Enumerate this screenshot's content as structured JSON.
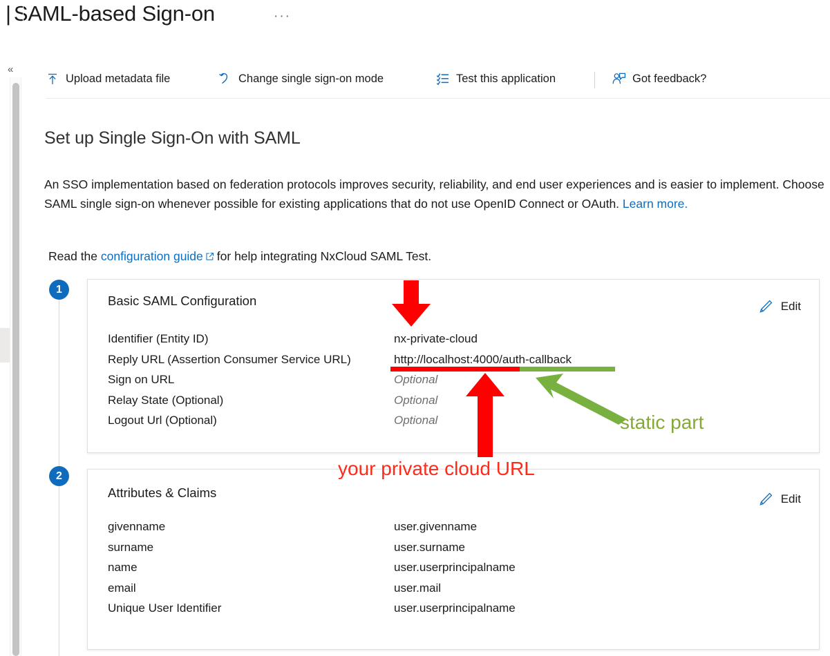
{
  "header": {
    "title_prefix": "|",
    "title": "SAML-based Sign-on",
    "ellipsis": "···",
    "collapse_icon": "«"
  },
  "command_bar": {
    "items": [
      {
        "label": "Upload metadata file",
        "icon": "upload-icon"
      },
      {
        "label": "Change single sign-on mode",
        "icon": "undo-arrow-icon"
      },
      {
        "label": "Test this application",
        "icon": "checklist-icon"
      },
      {
        "label": "Got feedback?",
        "icon": "feedback-person-icon"
      }
    ]
  },
  "main": {
    "heading": "Set up Single Sign-On with SAML",
    "intro_part1": "An SSO implementation based on federation protocols improves security, reliability, and end user experiences and is easier to implement. Choose SAML single sign-on whenever possible for existing applications that do not use OpenID Connect or OAuth. ",
    "intro_link": "Learn more.",
    "read_prefix": "Read the ",
    "read_link": "configuration guide",
    "read_suffix": "for help integrating NxCloud SAML Test."
  },
  "steps": [
    {
      "number": "1"
    },
    {
      "number": "2"
    }
  ],
  "cards": {
    "basic": {
      "title": "Basic SAML Configuration",
      "edit_label": "Edit",
      "rows": [
        {
          "key": "Identifier (Entity ID)",
          "value": "nx-private-cloud",
          "optional": false
        },
        {
          "key": "Reply URL (Assertion Consumer Service URL)",
          "value": "http://localhost:4000/auth-callback",
          "optional": false
        },
        {
          "key": "Sign on URL",
          "value": "Optional",
          "optional": true
        },
        {
          "key": "Relay State (Optional)",
          "value": "Optional",
          "optional": true
        },
        {
          "key": "Logout Url (Optional)",
          "value": "Optional",
          "optional": true
        }
      ]
    },
    "attributes": {
      "title": "Attributes & Claims",
      "edit_label": "Edit",
      "rows": [
        {
          "key": "givenname",
          "value": "user.givenname"
        },
        {
          "key": "surname",
          "value": "user.surname"
        },
        {
          "key": "name",
          "value": "user.userprincipalname"
        },
        {
          "key": "email",
          "value": "user.mail"
        },
        {
          "key": "Unique User Identifier",
          "value": "user.userprincipalname"
        }
      ]
    }
  },
  "annotations": {
    "static_part": "static part",
    "private_cloud_url": "your private cloud URL",
    "colors": {
      "red": "#fe0000",
      "red_text": "#fe2b1a",
      "green": "#78b13f",
      "green_text": "#85a938",
      "accent_blue": "#0f6cbd"
    }
  }
}
